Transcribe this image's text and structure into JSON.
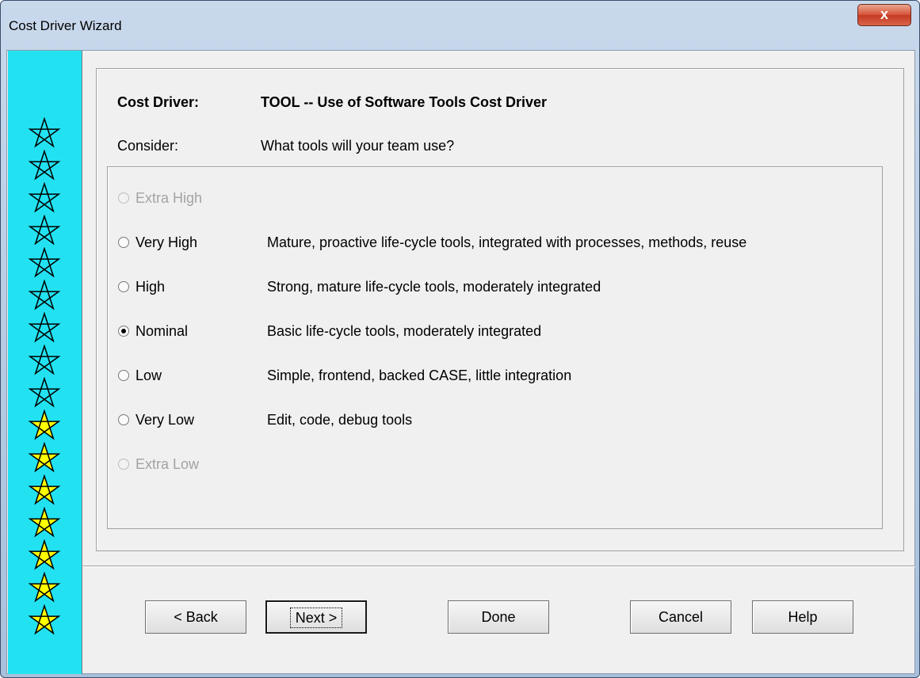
{
  "window": {
    "title": "Cost Driver Wizard",
    "close_label": "x"
  },
  "sidebar": {
    "stars": [
      {
        "filled": false
      },
      {
        "filled": false
      },
      {
        "filled": false
      },
      {
        "filled": false
      },
      {
        "filled": false
      },
      {
        "filled": false
      },
      {
        "filled": false
      },
      {
        "filled": false
      },
      {
        "filled": false
      },
      {
        "filled": true
      },
      {
        "filled": true
      },
      {
        "filled": true
      },
      {
        "filled": true
      },
      {
        "filled": true
      },
      {
        "filled": true
      },
      {
        "filled": true
      }
    ],
    "colors": {
      "background": "#22e2f2",
      "star_filled": "#ffff00",
      "star_outline": "#000000"
    }
  },
  "header": {
    "driver_label": "Cost Driver:",
    "driver_value": "TOOL -- Use of Software Tools Cost Driver",
    "consider_label": "Consider:",
    "consider_value": "What tools will your team use?"
  },
  "options": [
    {
      "label": "Extra High",
      "description": "",
      "enabled": false,
      "selected": false
    },
    {
      "label": "Very High",
      "description": "Mature, proactive life-cycle tools, integrated with processes, methods, reuse",
      "enabled": true,
      "selected": false
    },
    {
      "label": "High",
      "description": "Strong, mature life-cycle tools, moderately integrated",
      "enabled": true,
      "selected": false
    },
    {
      "label": "Nominal",
      "description": "Basic life-cycle tools, moderately integrated",
      "enabled": true,
      "selected": true
    },
    {
      "label": "Low",
      "description": "Simple, frontend, backed CASE, little integration",
      "enabled": true,
      "selected": false
    },
    {
      "label": "Very Low",
      "description": "Edit, code, debug tools",
      "enabled": true,
      "selected": false
    },
    {
      "label": "Extra Low",
      "description": "",
      "enabled": false,
      "selected": false
    }
  ],
  "buttons": {
    "back": "< Back",
    "next": "Next >",
    "done": "Done",
    "cancel": "Cancel",
    "help": "Help"
  }
}
